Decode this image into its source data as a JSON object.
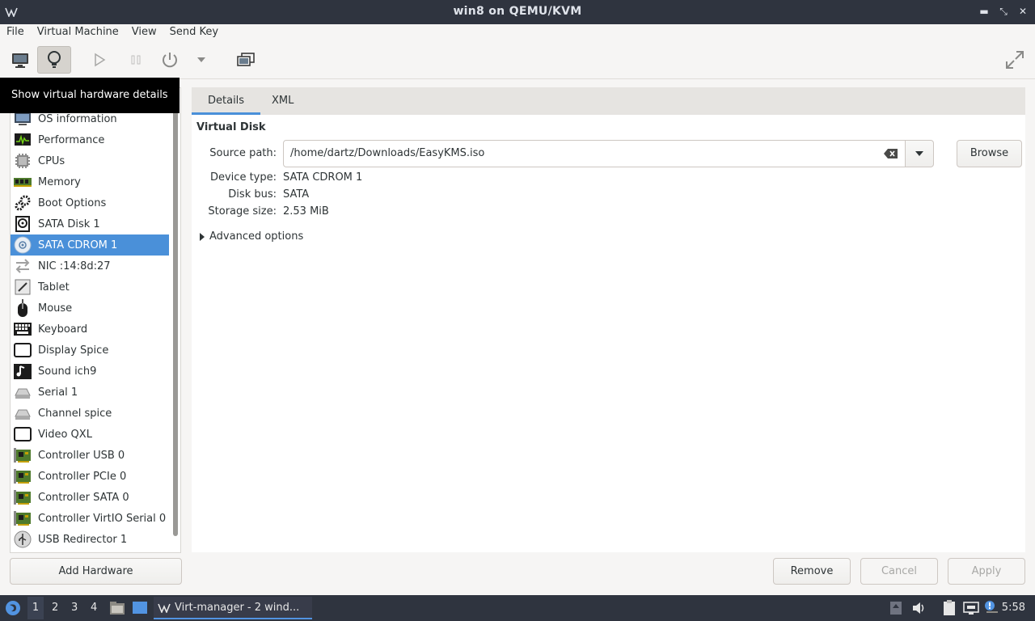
{
  "window": {
    "title": "win8 on QEMU/KVM"
  },
  "menubar": [
    "File",
    "Virtual Machine",
    "View",
    "Send Key"
  ],
  "toolbar": {
    "tooltip": "Show virtual hardware details"
  },
  "sidebar": {
    "items": [
      {
        "label": "OS information",
        "icon": "monitor-info-icon"
      },
      {
        "label": "Performance",
        "icon": "performance-graph-icon"
      },
      {
        "label": "CPUs",
        "icon": "cpu-chip-icon"
      },
      {
        "label": "Memory",
        "icon": "memory-module-icon"
      },
      {
        "label": "Boot Options",
        "icon": "gears-icon"
      },
      {
        "label": "SATA Disk 1",
        "icon": "hard-disk-icon"
      },
      {
        "label": "SATA CDROM 1",
        "icon": "cdrom-icon"
      },
      {
        "label": "NIC :14:8d:27",
        "icon": "network-arrows-icon"
      },
      {
        "label": "Tablet",
        "icon": "tablet-icon"
      },
      {
        "label": "Mouse",
        "icon": "mouse-icon"
      },
      {
        "label": "Keyboard",
        "icon": "keyboard-icon"
      },
      {
        "label": "Display Spice",
        "icon": "display-icon"
      },
      {
        "label": "Sound ich9",
        "icon": "sound-icon"
      },
      {
        "label": "Serial 1",
        "icon": "serial-port-icon"
      },
      {
        "label": "Channel spice",
        "icon": "channel-icon"
      },
      {
        "label": "Video QXL",
        "icon": "video-card-icon"
      },
      {
        "label": "Controller USB 0",
        "icon": "controller-card-icon"
      },
      {
        "label": "Controller PCIe 0",
        "icon": "controller-card-icon"
      },
      {
        "label": "Controller SATA 0",
        "icon": "controller-card-icon"
      },
      {
        "label": "Controller VirtIO Serial 0",
        "icon": "controller-card-icon"
      },
      {
        "label": "USB Redirector 1",
        "icon": "usb-icon"
      }
    ],
    "selected": "SATA CDROM 1",
    "add_hardware": "Add Hardware"
  },
  "tabs": [
    "Details",
    "XML"
  ],
  "details": {
    "section_title": "Virtual Disk",
    "source_path_label": "Source path:",
    "source_path_value": "/home/dartz/Downloads/EasyKMS.iso",
    "browse": "Browse",
    "device_type_label": "Device type:",
    "device_type_value": "SATA CDROM 1",
    "disk_bus_label": "Disk bus:",
    "disk_bus_value": "SATA",
    "storage_size_label": "Storage size:",
    "storage_size_value": "2.53 MiB",
    "advanced_options": "Advanced options"
  },
  "buttons": {
    "remove": "Remove",
    "cancel": "Cancel",
    "apply": "Apply"
  },
  "taskbar": {
    "workspaces": [
      "1",
      "2",
      "3",
      "4"
    ],
    "task": "Virt-manager - 2 wind...",
    "clock": "5:58"
  },
  "colors": {
    "accent": "#4a90d9",
    "titlebar": "#2f343f"
  }
}
